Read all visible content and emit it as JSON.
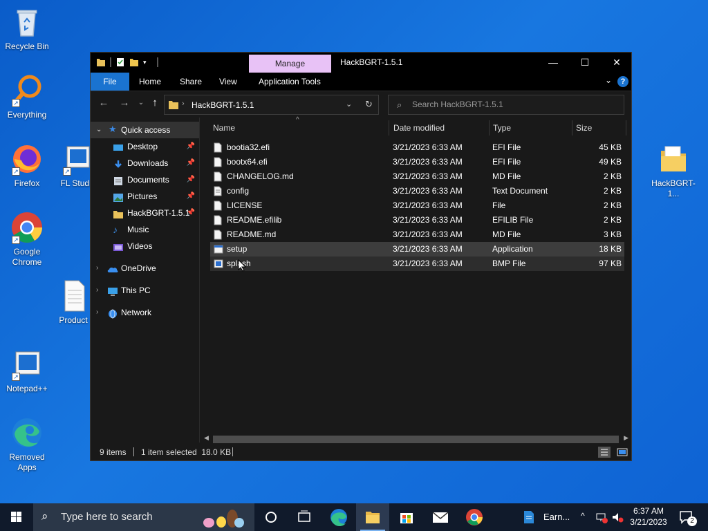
{
  "desktop": {
    "icons": [
      {
        "label": "Recycle Bin",
        "icon": "recycle-bin-icon"
      },
      {
        "label": "Everything",
        "icon": "everything-search-icon"
      },
      {
        "label": "Firefox",
        "icon": "firefox-icon"
      },
      {
        "label": "FL Studio",
        "icon": "fl-studio-icon"
      },
      {
        "label": "Google Chrome",
        "icon": "chrome-icon"
      },
      {
        "label": "Product",
        "icon": "document-icon"
      },
      {
        "label": "Notepad++",
        "icon": "notepadpp-icon"
      },
      {
        "label": "Removed Apps",
        "icon": "edge-icon"
      },
      {
        "label": "HackBGRT-1...",
        "icon": "folder-icon"
      }
    ]
  },
  "window": {
    "title": "HackBGRT-1.5.1",
    "contextual_tab": "Manage",
    "controls": {
      "minimize": "—",
      "maximize": "☐",
      "close": "✕"
    },
    "ribbon_tabs": [
      "File",
      "Home",
      "Share",
      "View",
      "Application Tools"
    ],
    "help": "?",
    "address": "HackBGRT-1.5.1",
    "search_placeholder": "Search HackBGRT-1.5.1"
  },
  "nav": {
    "items": [
      {
        "label": "Quick access",
        "icon": "star-icon",
        "pinned": false
      },
      {
        "label": "Desktop",
        "icon": "desktop-icon",
        "pinned": true
      },
      {
        "label": "Downloads",
        "icon": "download-icon",
        "pinned": true
      },
      {
        "label": "Documents",
        "icon": "documents-icon",
        "pinned": true
      },
      {
        "label": "Pictures",
        "icon": "pictures-icon",
        "pinned": true
      },
      {
        "label": "HackBGRT-1.5.1",
        "icon": "folder-icon",
        "pinned": true
      },
      {
        "label": "Music",
        "icon": "music-icon",
        "pinned": false
      },
      {
        "label": "Videos",
        "icon": "videos-icon",
        "pinned": false
      },
      {
        "label": "OneDrive",
        "icon": "cloud-icon",
        "pinned": false
      },
      {
        "label": "This PC",
        "icon": "computer-icon",
        "pinned": false
      },
      {
        "label": "Network",
        "icon": "network-icon",
        "pinned": false
      }
    ]
  },
  "files": {
    "columns": [
      "Name",
      "Date modified",
      "Type",
      "Size"
    ],
    "rows": [
      {
        "name": "bootia32.efi",
        "date": "3/21/2023 6:33 AM",
        "type": "EFI File",
        "size": "45 KB",
        "icon": "file-icon"
      },
      {
        "name": "bootx64.efi",
        "date": "3/21/2023 6:33 AM",
        "type": "EFI File",
        "size": "49 KB",
        "icon": "file-icon"
      },
      {
        "name": "CHANGELOG.md",
        "date": "3/21/2023 6:33 AM",
        "type": "MD File",
        "size": "2 KB",
        "icon": "file-icon"
      },
      {
        "name": "config",
        "date": "3/21/2023 6:33 AM",
        "type": "Text Document",
        "size": "2 KB",
        "icon": "text-file-icon"
      },
      {
        "name": "LICENSE",
        "date": "3/21/2023 6:33 AM",
        "type": "File",
        "size": "2 KB",
        "icon": "file-icon"
      },
      {
        "name": "README.efilib",
        "date": "3/21/2023 6:33 AM",
        "type": "EFILIB File",
        "size": "2 KB",
        "icon": "file-icon"
      },
      {
        "name": "README.md",
        "date": "3/21/2023 6:33 AM",
        "type": "MD File",
        "size": "3 KB",
        "icon": "file-icon"
      },
      {
        "name": "setup",
        "date": "3/21/2023 6:33 AM",
        "type": "Application",
        "size": "18 KB",
        "icon": "application-icon"
      },
      {
        "name": "splash",
        "date": "3/21/2023 6:33 AM",
        "type": "BMP File",
        "size": "97 KB",
        "icon": "bitmap-icon"
      }
    ]
  },
  "status": {
    "count": "9 items",
    "selection": "1 item selected  18.0 KB"
  },
  "taskbar": {
    "search_placeholder": "Type here to search",
    "pinned_label": "Earn...",
    "time": "6:37 AM",
    "date": "3/21/2023",
    "notifications": "2"
  }
}
